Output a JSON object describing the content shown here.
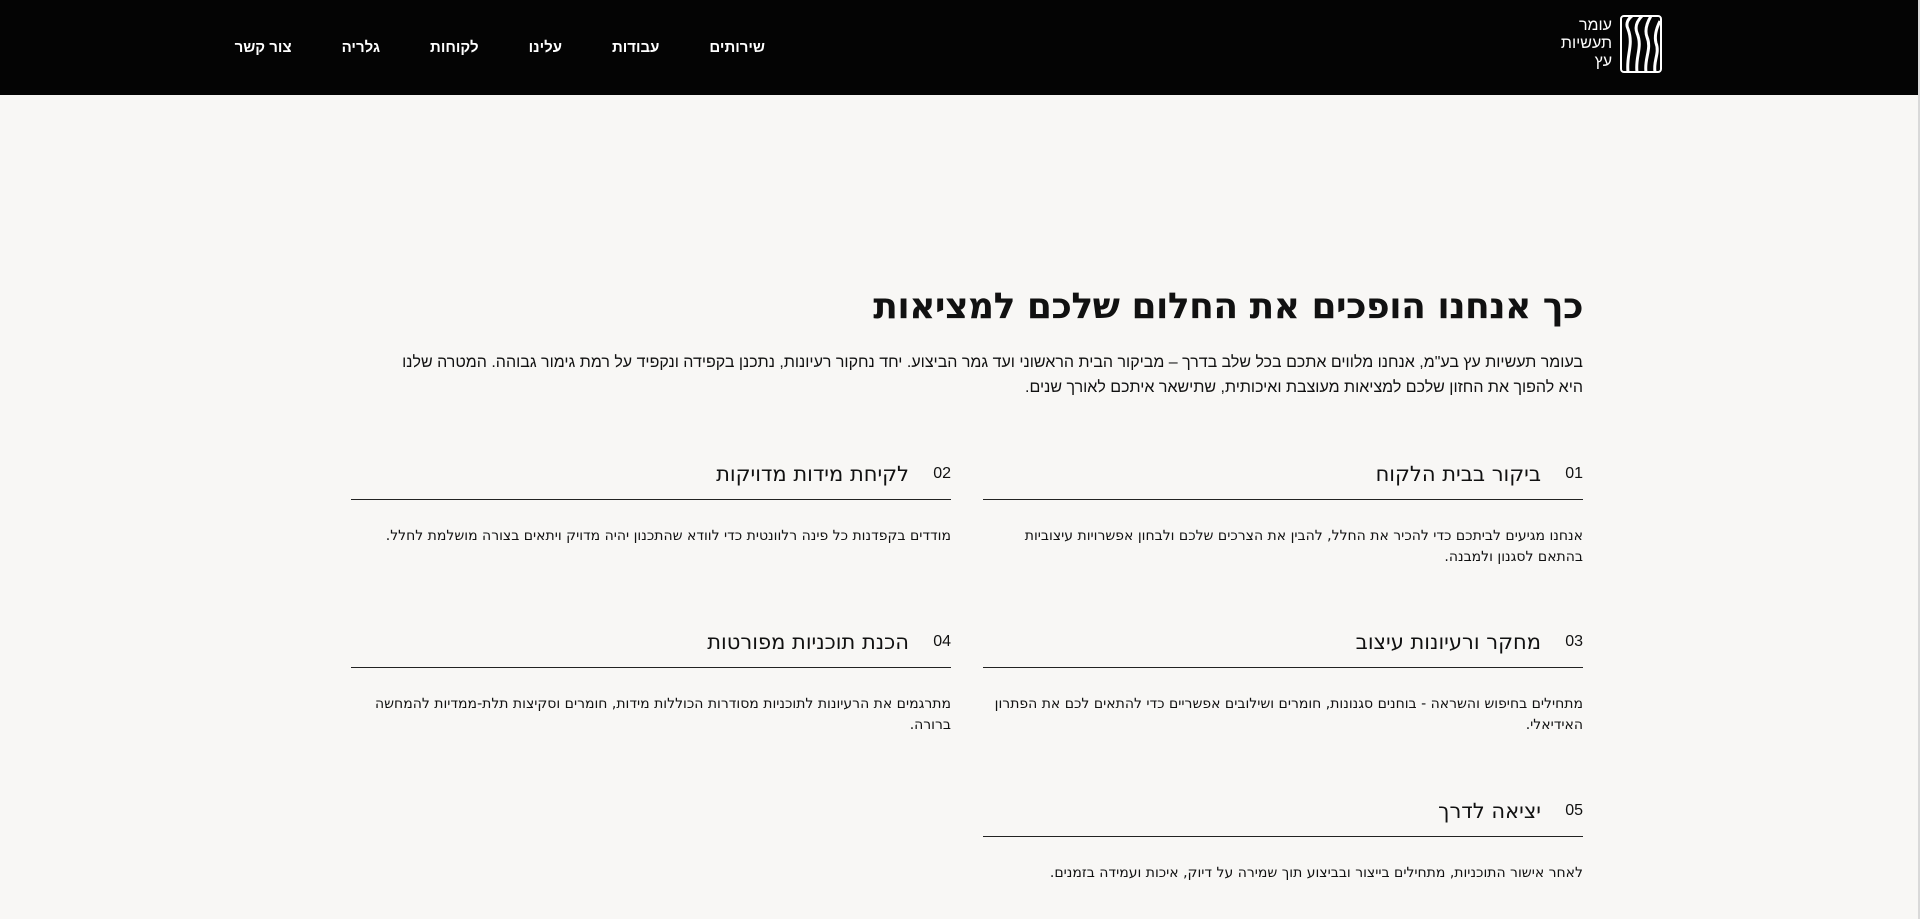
{
  "brand": {
    "logo_lines": [
      "עומר",
      "תעשיות",
      "עץ"
    ]
  },
  "nav": {
    "items": [
      {
        "label": "שירותים"
      },
      {
        "label": "עבודות"
      },
      {
        "label": "עלינו"
      },
      {
        "label": "לקוחות"
      },
      {
        "label": "גלריה"
      },
      {
        "label": "צור קשר"
      }
    ]
  },
  "hero": {
    "title": "כך אנחנו הופכים את החלום שלכם למציאות",
    "intro": "בעומר תעשיות עץ בע\"מ, אנחנו מלווים אתכם בכל שלב בדרך – מביקור הבית הראשוני ועד גמר הביצוע. יחד נחקור רעיונות, נתכנן בקפידה ונקפיד על רמת גימור גבוהה. המטרה שלנו היא להפוך את החזון שלכם למציאות מעוצבת ואיכותית, שתישאר איתכם לאורך שנים."
  },
  "steps": [
    {
      "num": "01",
      "title": "ביקור בבית הלקוח",
      "desc": "אנחנו מגיעים לביתכם כדי להכיר את החלל, להבין את הצרכים שלכם ולבחון אפשרויות עיצוביות בהתאם לסגנון ולמבנה."
    },
    {
      "num": "02",
      "title": "לקיחת מידות מדויקות",
      "desc": "מודדים בקפדנות כל פינה רלוונטית כדי לוודא שהתכנון יהיה מדויק ויתאים בצורה מושלמת לחלל."
    },
    {
      "num": "03",
      "title": "מחקר ורעיונות עיצוב",
      "desc": "מתחילים בחיפוש והשראה - בוחנים סגנונות, חומרים ושילובים אפשריים כדי להתאים לכם את הפתרון האידיאלי."
    },
    {
      "num": "04",
      "title": "הכנת תוכניות מפורטות",
      "desc": "מתרגמים את הרעיונות לתוכניות מסודרות הכוללות מידות, חומרים וסקיצות תלת-ממדיות להמחשה ברורה."
    },
    {
      "num": "05",
      "title": "יציאה לדרך",
      "desc": "לאחר אישור התוכניות, מתחילים בייצור ובביצוע תוך שמירה על דיוק, איכות ועמידה בזמנים."
    }
  ],
  "colors": {
    "header_bg": "#040404",
    "page_bg": "#f8f7f5",
    "text": "#111111"
  }
}
